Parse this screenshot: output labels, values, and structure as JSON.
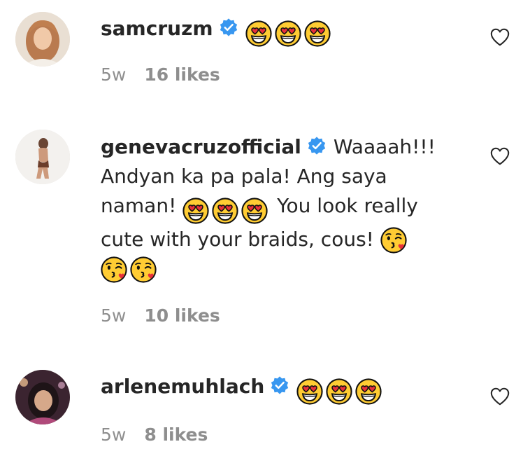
{
  "comments": [
    {
      "username": "samcruzm",
      "text_before": "",
      "emojis_inline": [
        "heart-eyes",
        "heart-eyes",
        "heart-eyes"
      ],
      "text": "",
      "time": "5w",
      "likes": "16 likes"
    },
    {
      "username": "genevacruzofficial",
      "line1": "Waaaah!!!",
      "line2": "Andyan ka pa pala! Ang saya",
      "line3_text_a": "naman!",
      "line3_text_b": "You look really",
      "line4": "cute with your braids, cous!",
      "time": "5w",
      "likes": "10 likes"
    },
    {
      "username": "arlenemuhlach",
      "time": "5w",
      "likes": "8 likes"
    }
  ],
  "colors": {
    "verified": "#3897f0",
    "meta": "#8e8e8e",
    "text": "#262626"
  },
  "icons": [
    "verified-badge-icon",
    "heart-eyes-emoji",
    "kissing-heart-emoji",
    "heart-outline-icon"
  ]
}
